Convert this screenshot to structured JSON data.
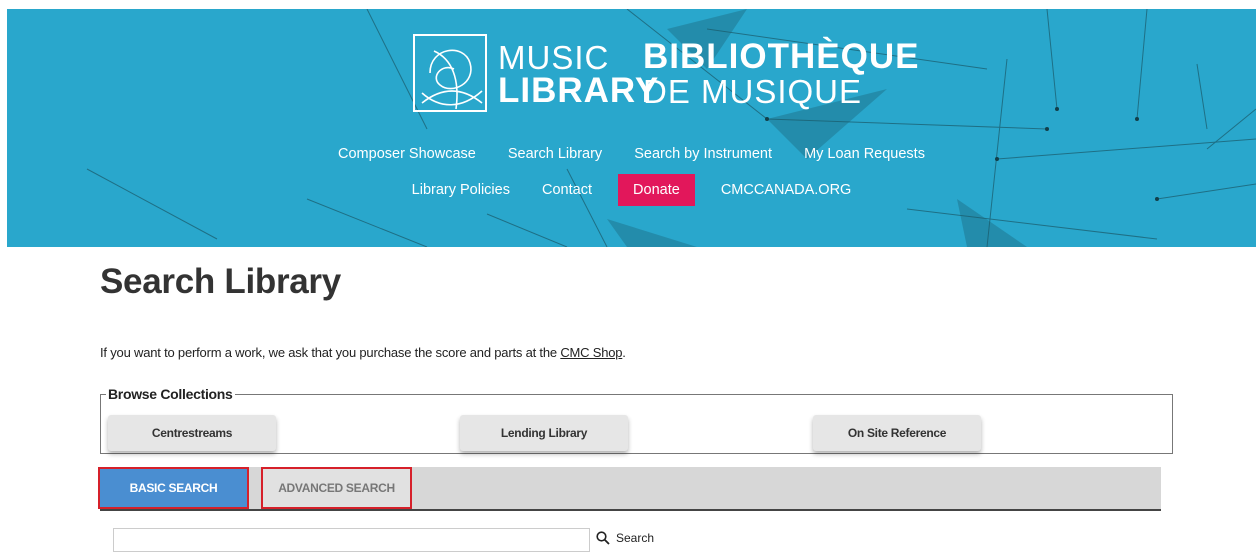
{
  "header": {
    "logo_en_line1": "MUSIC",
    "logo_en_line2": "LIBRARY",
    "logo_fr_line1": "BIBLIOTHÈQUE",
    "logo_fr_line2": "DE MUSIQUE",
    "nav_row1": [
      {
        "label": "Composer Showcase"
      },
      {
        "label": "Search Library"
      },
      {
        "label": "Search by Instrument"
      },
      {
        "label": "My Loan Requests"
      }
    ],
    "nav_row2": [
      {
        "label": "Library Policies"
      },
      {
        "label": "Contact"
      },
      {
        "label": "Donate"
      },
      {
        "label": "CMCCANADA.ORG"
      }
    ],
    "banner_color": "#29a7cc",
    "donate_color": "#e2175b"
  },
  "main": {
    "title": "Search Library",
    "intro_text": "If you want to perform a work, we ask that you purchase the score and parts at the ",
    "intro_link": "CMC Shop",
    "intro_end": "."
  },
  "browse": {
    "legend": "Browse Collections",
    "buttons": [
      {
        "label": "Centrestreams"
      },
      {
        "label": "Lending Library"
      },
      {
        "label": "On Site Reference"
      }
    ]
  },
  "tabs": [
    {
      "label": "BASIC SEARCH",
      "active": true
    },
    {
      "label": "ADVANCED SEARCH",
      "active": false
    }
  ],
  "search": {
    "value": "",
    "button_label": "Search",
    "icon": "search-icon"
  },
  "colors": {
    "active_tab": "#4a8ed1",
    "highlight_border": "#d6202a"
  }
}
